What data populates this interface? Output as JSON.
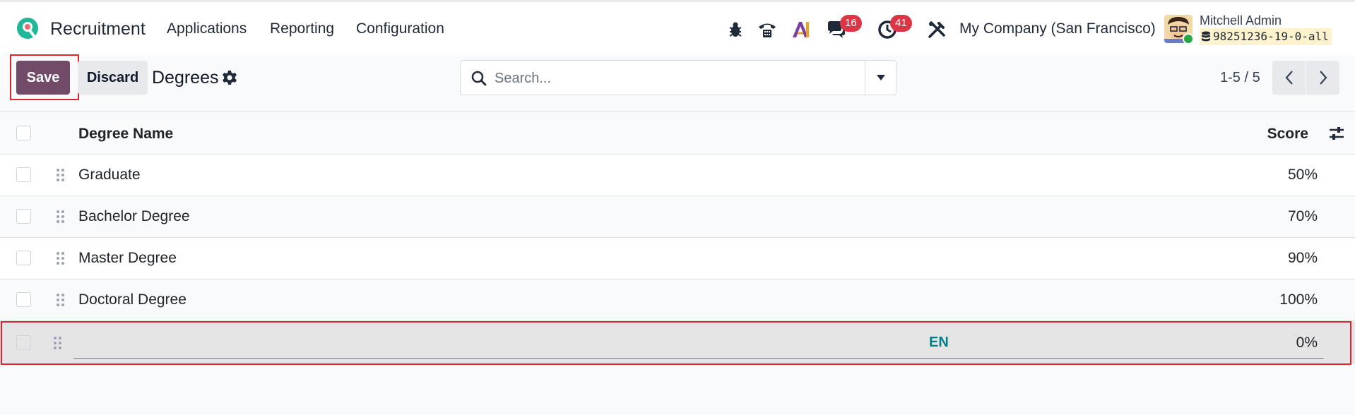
{
  "navbar": {
    "app_name": "Recruitment",
    "menu": [
      "Applications",
      "Reporting",
      "Configuration"
    ],
    "discuss_badge": "16",
    "activity_badge": "41",
    "company": "My Company (San Francisco)",
    "user_name": "Mitchell Admin",
    "db_name": "98251236-19-0-all",
    "icons": [
      "bug-icon",
      "phone-icon",
      "ai-icon",
      "chat-icon",
      "clock-icon",
      "tools-icon"
    ]
  },
  "control_panel": {
    "save_label": "Save",
    "discard_label": "Discard",
    "title": "Degrees",
    "search_placeholder": "Search...",
    "pager": "1-5 / 5"
  },
  "list": {
    "columns": [
      "Degree Name",
      "Score"
    ],
    "rows": [
      {
        "name": "Graduate",
        "score": "50%"
      },
      {
        "name": "Bachelor Degree",
        "score": "70%"
      },
      {
        "name": "Master Degree",
        "score": "90%"
      },
      {
        "name": "Doctoral Degree",
        "score": "100%"
      }
    ],
    "edit_row": {
      "name": "",
      "lang": "EN",
      "score": "0%"
    }
  },
  "colors": {
    "primary": "#714b67",
    "highlight": "#e0242f",
    "badge": "#dc3545",
    "lang_tag": "#017e84"
  }
}
